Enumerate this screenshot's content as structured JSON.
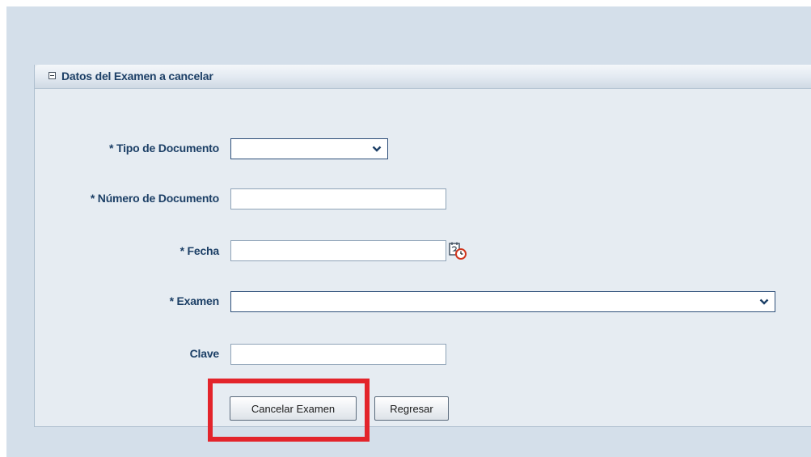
{
  "panel": {
    "title": "Datos del Examen a cancelar",
    "collapse_icon": "minus-box-icon"
  },
  "form": {
    "tipo_documento": {
      "label": "* Tipo de Documento",
      "value": "",
      "icon": "chevron-down-icon"
    },
    "numero_documento": {
      "label": "* Número de Documento",
      "value": ""
    },
    "fecha": {
      "label": "* Fecha",
      "value": "",
      "icon": "calendar-clock-icon"
    },
    "examen": {
      "label": "* Examen",
      "value": "",
      "icon": "chevron-down-icon"
    },
    "clave": {
      "label": "Clave",
      "value": ""
    }
  },
  "actions": {
    "cancelar_label": "Cancelar Examen",
    "regresar_label": "Regresar"
  },
  "colors": {
    "page_background": "#d4dfea",
    "panel_background": "#e6ecf2",
    "label_color": "#1c3f66",
    "highlight": "#e3242b"
  }
}
